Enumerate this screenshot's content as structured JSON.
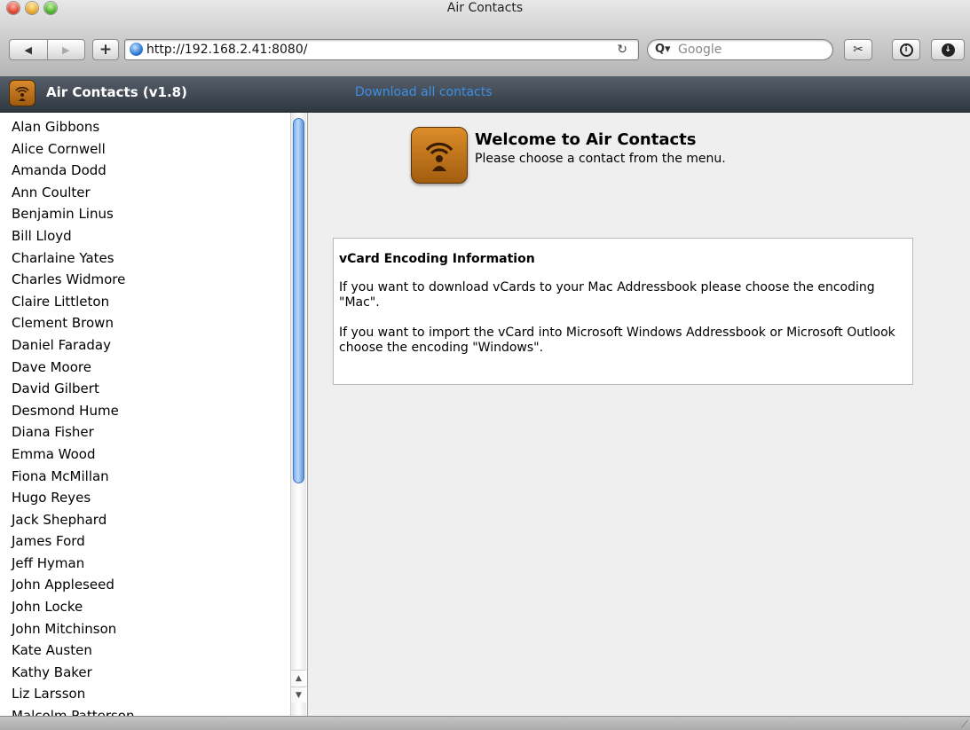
{
  "window": {
    "title": "Air Contacts"
  },
  "toolbar": {
    "back_glyph": "◀",
    "forward_glyph": "▶",
    "add_glyph": "+",
    "url": "http://192.168.2.41:8080/",
    "reload_glyph": "↻",
    "search_glyph": "Q▾",
    "search_placeholder": "Google",
    "snip_glyph": "✂",
    "info_glyph": "i",
    "download_glyph": "↓"
  },
  "header": {
    "app_name": "Air Contacts (v1.8)",
    "download_link": "Download all contacts",
    "link_color": "#3d8ee6"
  },
  "sidebar": {
    "contacts": [
      "Alan Gibbons",
      "Alice Cornwell",
      "Amanda Dodd",
      "Ann Coulter",
      "Benjamin Linus",
      "Bill Lloyd",
      "Charlaine Yates",
      "Charles Widmore",
      "Claire Littleton",
      "Clement Brown",
      "Daniel Faraday",
      "Dave Moore",
      "David Gilbert",
      "Desmond Hume",
      "Diana Fisher",
      "Emma Wood",
      "Fiona McMillan",
      "Hugo Reyes",
      "Jack Shephard",
      "James Ford",
      "Jeff Hyman",
      "John Appleseed",
      "John Locke",
      "John Mitchinson",
      "Kate Austen",
      "Kathy Baker",
      "Liz Larsson",
      "Malcolm Patterson"
    ],
    "scroll_up_glyph": "▲",
    "scroll_down_glyph": "▼"
  },
  "main": {
    "welcome_title": "Welcome to Air Contacts",
    "welcome_subtitle": "Please choose a contact from the menu.",
    "info_title": "vCard Encoding Information",
    "info_para_1": "If you want to download vCards to your Mac Addressbook please choose the encoding \"Mac\".",
    "info_para_2": "If you want to import the vCard into Microsoft Windows Addressbook or Microsoft Outlook choose the encoding \"Windows\"."
  },
  "icons": {
    "app": "air-contacts-icon",
    "globe": "globe-icon",
    "accent_orange": "#c97a1e"
  }
}
